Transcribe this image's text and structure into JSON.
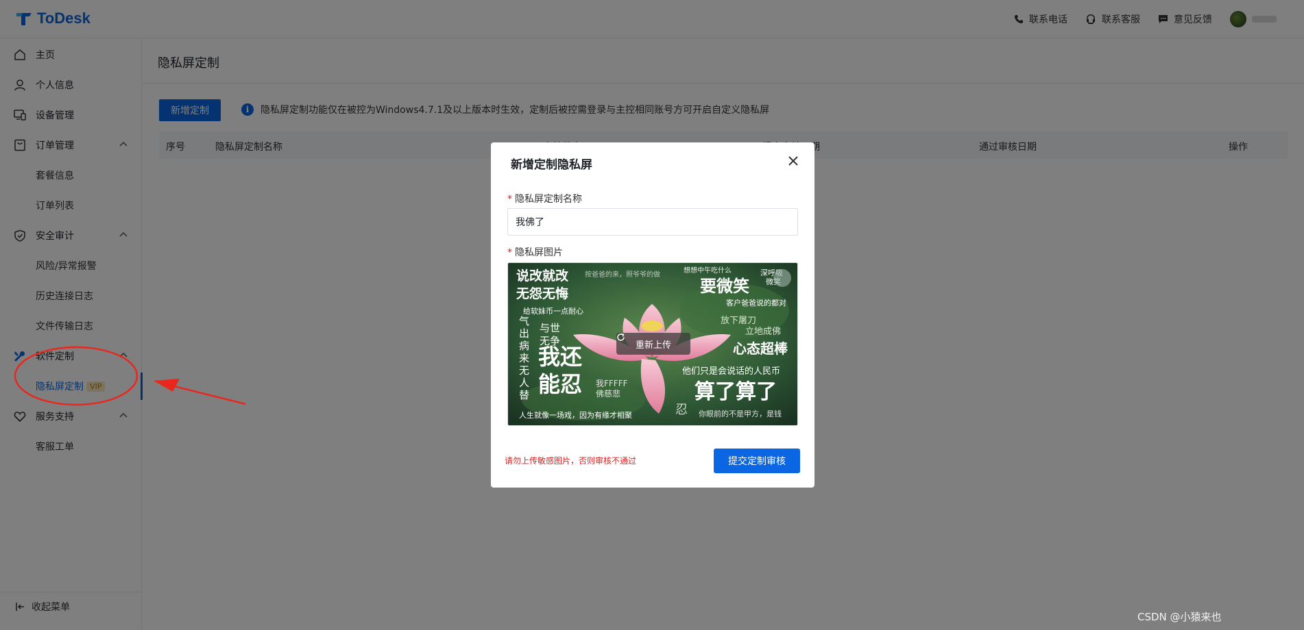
{
  "app": {
    "name": "ToDesk",
    "brand_color": "#0a66e3"
  },
  "header": {
    "links": [
      {
        "label": "联系电话",
        "icon": "phone-icon"
      },
      {
        "label": "联系客服",
        "icon": "headset-icon"
      },
      {
        "label": "意见反馈",
        "icon": "feedback-icon"
      }
    ]
  },
  "sidebar": {
    "items": [
      {
        "label": "主页",
        "icon": "home-icon"
      },
      {
        "label": "个人信息",
        "icon": "user-icon"
      },
      {
        "label": "设备管理",
        "icon": "devices-icon"
      },
      {
        "label": "订单管理",
        "icon": "order-icon",
        "expanded": true
      },
      {
        "label": "套餐信息"
      },
      {
        "label": "订单列表"
      },
      {
        "label": "安全审计",
        "icon": "shield-icon",
        "expanded": true
      },
      {
        "label": "风险/异常报警"
      },
      {
        "label": "历史连接日志"
      },
      {
        "label": "文件传输日志"
      },
      {
        "label": "软件定制",
        "icon": "customize-icon",
        "expanded": true
      },
      {
        "label": "隐私屏定制",
        "badge": "VIP",
        "active": true
      },
      {
        "label": "服务支持",
        "icon": "heart-icon",
        "expanded": true
      },
      {
        "label": "客服工单"
      }
    ],
    "collapse_label": "收起菜单"
  },
  "main": {
    "title": "隐私屏定制",
    "new_button": "新增定制",
    "notice": "隐私屏定制功能仅在被控为Windows4.7.1及以上版本时生效，定制后被控需登录与主控相同账号方可开启自定义隐私屏",
    "table": {
      "columns": [
        "序号",
        "隐私屏定制名称",
        "审核状态",
        "提交审核日期",
        "通过审核日期",
        "操作"
      ]
    }
  },
  "modal": {
    "title": "新增定制隐私屏",
    "name_label": "隐私屏定制名称",
    "name_value": "我佛了",
    "image_label": "隐私屏图片",
    "reupload_label": "重新上传",
    "warning": "请勿上传敏感图片，否则审核不通过",
    "submit_label": "提交定制审核",
    "image_texts": {
      "t1": "说改就改",
      "t2": "无怨无悔",
      "t3": "按爸爸的来，照爷爷的做",
      "t4": "想想中午吃什么",
      "t5": "深呼吸",
      "t6": "微笑",
      "t7": "要微笑",
      "t8": "客户爸爸说的都对",
      "t9": "给软妹币一点耐心",
      "t10": "放下屠刀",
      "t11": "立地成佛",
      "t12": "心态超棒",
      "t13": "他们只是会说话的人民币",
      "t14": "算了算了",
      "t15": "你眼前的不是甲方，是钱",
      "t16": "我还",
      "t17": "能忍",
      "t18": "我FFFFF",
      "t19": "佛慈悲",
      "t20": "忍",
      "t21": "人生就像一场戏，因为有缘才相聚",
      "t22": "与世",
      "t23": "无争",
      "t24": [
        "气",
        "出",
        "病",
        "来",
        "无",
        "人",
        "替"
      ]
    }
  },
  "watermark": "CSDN @小猿来也",
  "colors": {
    "overlay": "rgba(0,0,0,0.5)",
    "warning": "#e02020",
    "annotation": "#e8281e"
  }
}
